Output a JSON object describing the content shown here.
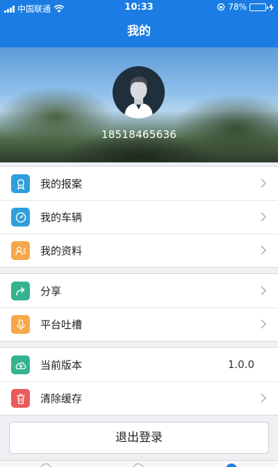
{
  "status_bar": {
    "carrier": "中国联通",
    "time": "10:33",
    "battery": "78%",
    "battery_level": 0.78
  },
  "header": {
    "title": "我的"
  },
  "profile": {
    "phone": "18518465636"
  },
  "menu": {
    "group1": [
      {
        "label": "我的报案",
        "icon": "award-icon",
        "color": "#2f9fdc"
      },
      {
        "label": "我的车辆",
        "icon": "speedometer-icon",
        "color": "#2f9fdc"
      },
      {
        "label": "我的资料",
        "icon": "profile-card-icon",
        "color": "#f5a84a"
      }
    ],
    "group2": [
      {
        "label": "分享",
        "icon": "share-icon",
        "color": "#35b390"
      },
      {
        "label": "平台吐槽",
        "icon": "microphone-icon",
        "color": "#f5a84a"
      }
    ],
    "group3": [
      {
        "label": "当前版本",
        "icon": "cloud-upload-icon",
        "color": "#35b390",
        "value": "1.0.0"
      },
      {
        "label": "清除缓存",
        "icon": "trash-icon",
        "color": "#ec5b5b"
      }
    ]
  },
  "logout": {
    "label": "退出登录"
  },
  "colors": {
    "accent": "#1b7de3",
    "background": "#efeff4"
  }
}
